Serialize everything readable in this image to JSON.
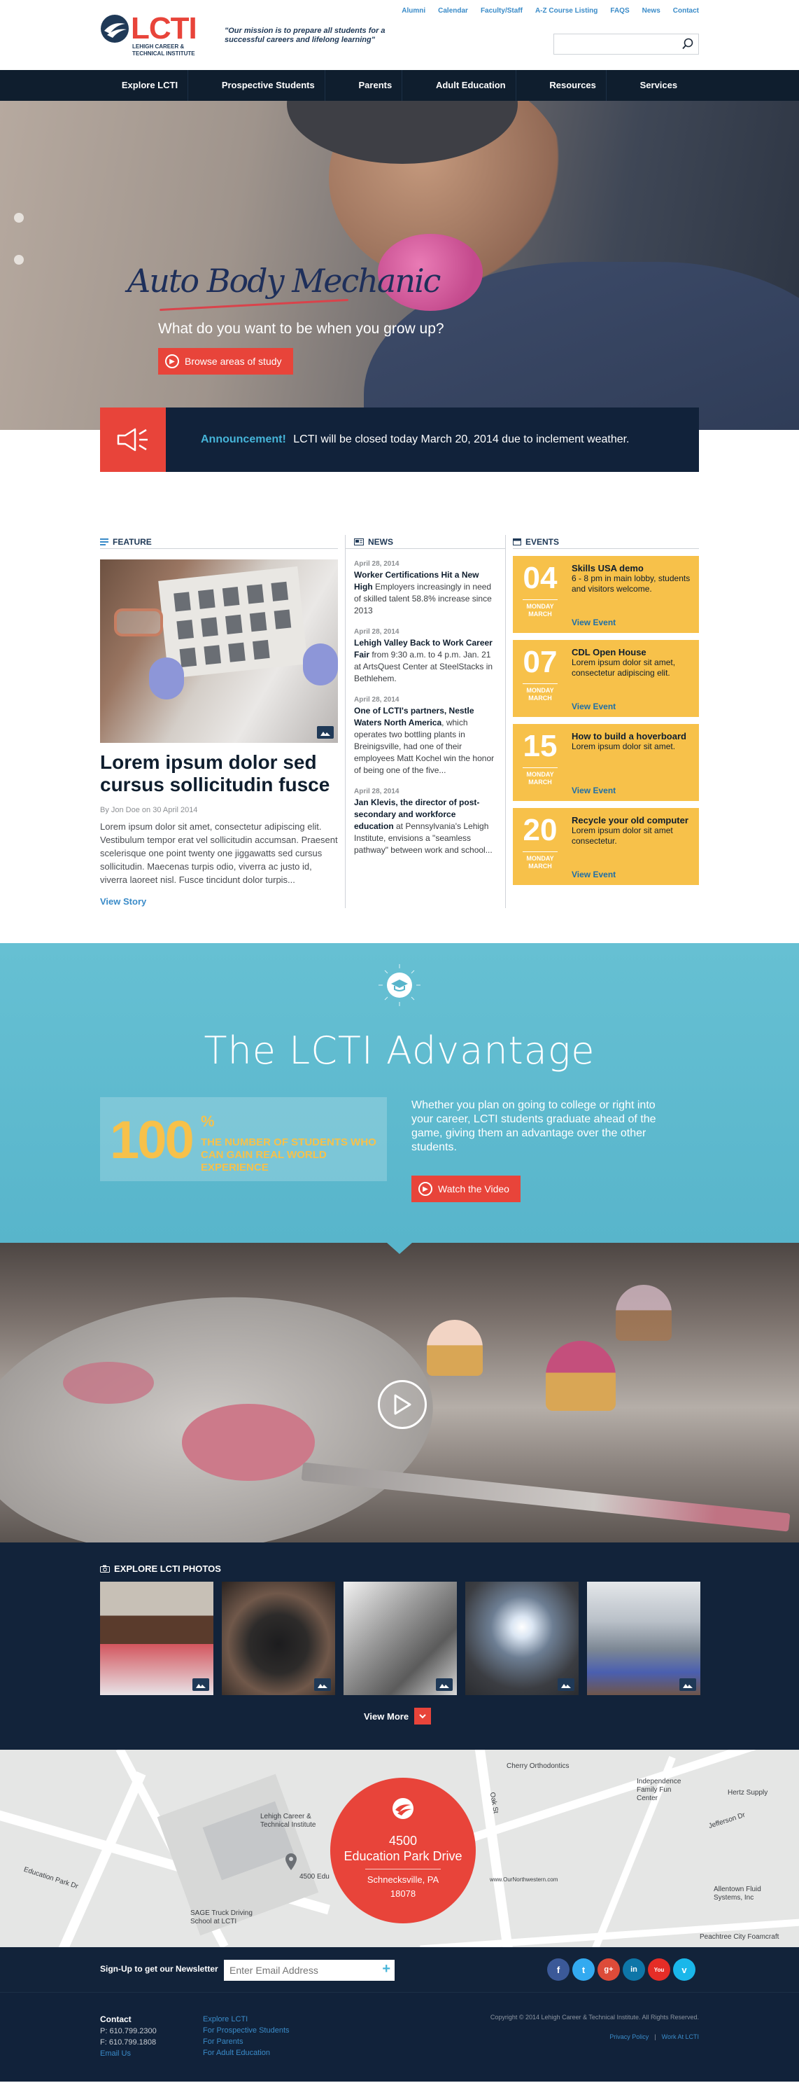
{
  "header": {
    "logo_text": "LCTI",
    "logo_subtitle": "LEHIGH CAREER & TECHNICAL INSTITUTE",
    "mission": "\"Our mission is to prepare all students for a successful careers and lifelong learning\"",
    "top_links": [
      "Alumni",
      "Calendar",
      "Faculty/Staff",
      "A-Z Course Listing",
      "FAQS",
      "News",
      "Contact"
    ],
    "search_placeholder": ""
  },
  "nav": {
    "items": [
      "Explore LCTI",
      "Prospective Students",
      "Parents",
      "Adult Education",
      "Resources",
      "Services"
    ]
  },
  "hero": {
    "script_text": "Auto Body Mechanic",
    "question": "What do you want to be when you grow up?",
    "button_label": "Browse areas of study"
  },
  "announcement": {
    "label": "Announcement!",
    "text": "LCTI will be closed today March 20, 2014 due to inclement weather."
  },
  "feature": {
    "heading": "FEATURE",
    "title": "Lorem ipsum dolor sed cursus sollicitudin fusce",
    "byline": "By Jon Doe on 30 April 2014",
    "body": "Lorem ipsum dolor sit amet, consectetur adipiscing elit. Vestibulum tempor erat vel sollicitudin accumsan. Praesent scelerisque one point twenty one jiggawatts sed cursus sollicitudin. Maecenas turpis odio, viverra ac justo id, viverra laoreet nisl. Fusce tincidunt dolor turpis...",
    "link": "View Story"
  },
  "news": {
    "heading": "NEWS",
    "items": [
      {
        "date": "April 28, 2014",
        "bold": "Worker Certifications Hit a New High",
        "rest": " Employers increasingly in need of skilled talent 58.8% increase since 2013"
      },
      {
        "date": "April 28, 2014",
        "bold": "Lehigh Valley Back to Work Career Fair",
        "rest": " from 9:30 a.m. to 4 p.m. Jan. 21 at ArtsQuest Center at SteelStacks in Bethlehem."
      },
      {
        "date": "April 28, 2014",
        "bold": "One of LCTI's partners, Nestle Waters North America",
        "rest": ", which operates two bottling plants in Breinigsville, had one of their employees Matt Kochel win the honor of being one of the five..."
      },
      {
        "date": "April 28, 2014",
        "bold": "Jan Klevis, the director of post-secondary and workforce education",
        "rest": " at Pennsylvania's Lehigh Institute, envisions a \"seamless pathway\" between work and school..."
      }
    ]
  },
  "events": {
    "heading": "EVENTS",
    "link_label": "View Event",
    "items": [
      {
        "day": "04",
        "weekday": "MONDAY",
        "month": "MARCH",
        "title": "Skills USA demo",
        "desc": "6 - 8 pm in main lobby, students and visitors welcome."
      },
      {
        "day": "07",
        "weekday": "MONDAY",
        "month": "MARCH",
        "title": "CDL Open House",
        "desc": "Lorem ipsum dolor sit amet, consectetur adipiscing elit."
      },
      {
        "day": "15",
        "weekday": "MONDAY",
        "month": "MARCH",
        "title": "How to build a hoverboard",
        "desc": "Lorem ipsum dolor sit amet."
      },
      {
        "day": "20",
        "weekday": "MONDAY",
        "month": "MARCH",
        "title": "Recycle your old computer",
        "desc": "Lorem ipsum dolor sit amet consectetur."
      }
    ]
  },
  "advantage": {
    "title": "The LCTI Advantage",
    "stat_number": "100",
    "stat_percent": "%",
    "stat_text": "THE NUMBER OF STUDENTS WHO CAN GAIN REAL WORLD EXPERIENCE",
    "copy": "Whether you plan on going to college or right into your career, LCTI students graduate ahead of the game, giving them an advantage over the other students.",
    "button_label": "Watch the Video"
  },
  "photos": {
    "heading": "EXPLORE LCTI PHOTOS",
    "view_more": "View More"
  },
  "map": {
    "address_line1": "4500",
    "address_line2": "Education Park Drive",
    "city": "Schnecksville, PA",
    "zip": "18078",
    "labels": [
      "Cherry Orthodontics",
      "Independence Family Fun Center",
      "Hertz Supply",
      "Lehigh Career & Technical Institute",
      "Education Park Dr",
      "4500 Edu",
      "Jefferson Dr",
      "Allentown Fluid Systems, Inc",
      "SAGE Truck Driving School at LCTI",
      "Peachtree City Foamcraft",
      "www.OurNorthwestern.com",
      "Oak St"
    ]
  },
  "newsletter": {
    "label": "Sign-Up to get our Newsletter",
    "placeholder": "Enter Email Address"
  },
  "socials": [
    {
      "name": "facebook",
      "glyph": "f",
      "color": "#3b5998"
    },
    {
      "name": "twitter",
      "glyph": "t",
      "color": "#33aaf0"
    },
    {
      "name": "google-plus",
      "glyph": "g+",
      "color": "#dd4b39"
    },
    {
      "name": "linkedin",
      "glyph": "in",
      "color": "#0e76a8"
    },
    {
      "name": "youtube",
      "glyph": "You",
      "color": "#e52d27"
    },
    {
      "name": "vimeo",
      "glyph": "v",
      "color": "#1ab7ea"
    }
  ],
  "footer": {
    "contact_heading": "Contact",
    "phone": "P: 610.799.2300",
    "fax": "F: 610.799.1808",
    "email": "Email Us",
    "links": [
      "Explore LCTI",
      "For Prospective Students",
      "For Parents",
      "For Adult Education"
    ],
    "copyright": "Copyright © 2014 Lehigh Career & Technical Institute. All Rights Reserved.",
    "privacy": "Privacy Policy",
    "separator": "|",
    "work": "Work At LCTI"
  },
  "colors": {
    "brand_red": "#e8443a",
    "navy": "#0f1e2e",
    "teal": "#58b5cb",
    "event_yellow": "#f7c14a",
    "link_blue": "#3a8bc8"
  }
}
